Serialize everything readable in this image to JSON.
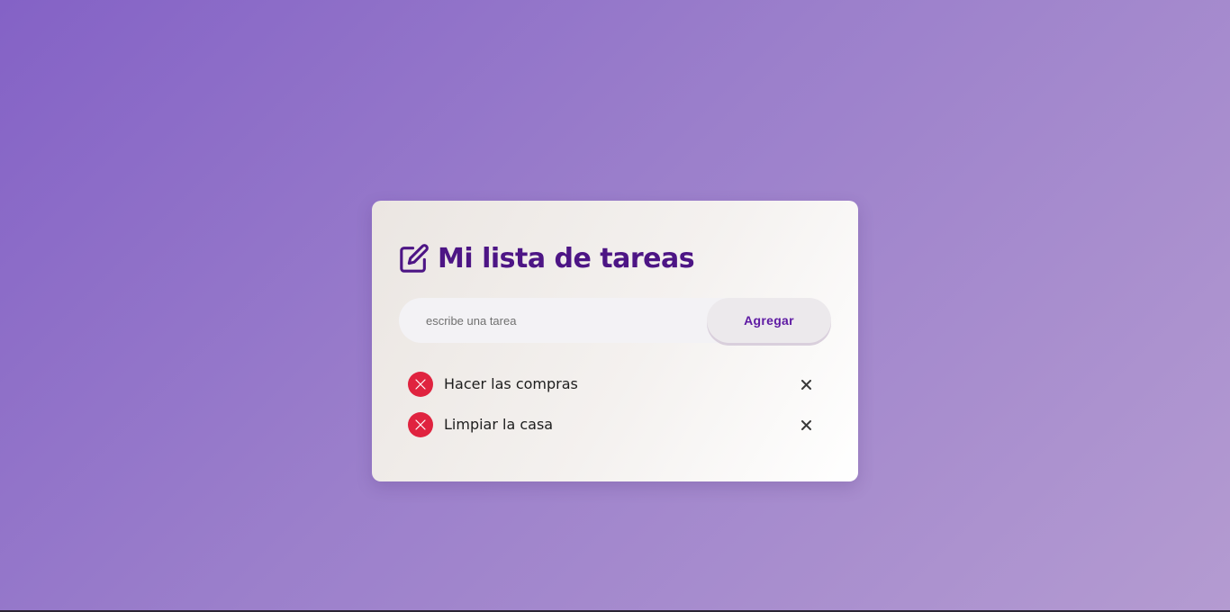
{
  "app": {
    "title": "Mi lista de tareas",
    "title_icon": "edit-icon"
  },
  "form": {
    "placeholder": "escribe una tarea",
    "value": "",
    "add_label": "Agregar"
  },
  "tasks": [
    {
      "text": "Hacer las compras",
      "status_icon": "x-circle-icon",
      "delete_icon": "close-icon"
    },
    {
      "text": "Limpiar la casa",
      "status_icon": "x-circle-icon",
      "delete_icon": "close-icon"
    }
  ],
  "colors": {
    "title": "#4d1585",
    "accent": "#5e1aa3",
    "status_red": "#e0233f",
    "background_start": "#8462c6",
    "background_end": "#b49bd1"
  }
}
